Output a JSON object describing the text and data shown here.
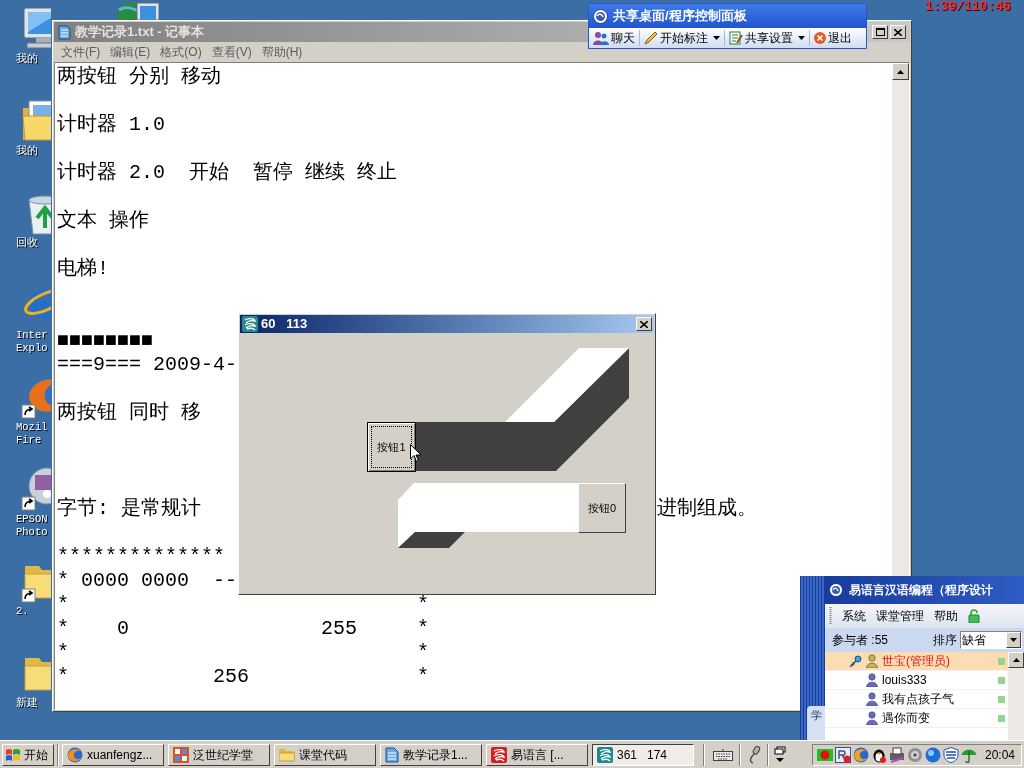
{
  "recording_time": "1:39/110:46",
  "desktop_icons": [
    {
      "kind": "computer",
      "lines": [
        "我的"
      ],
      "shortcut": false
    },
    {
      "kind": "documents",
      "lines": [
        "我的"
      ],
      "shortcut": false
    },
    {
      "kind": "recycle",
      "lines": [
        "回收"
      ],
      "shortcut": false
    },
    {
      "kind": "browser_e",
      "lines": [
        "Inter",
        "Explo"
      ],
      "shortcut": false
    },
    {
      "kind": "fox",
      "lines": [
        "Mozil",
        "Fire"
      ],
      "shortcut": true
    },
    {
      "kind": "photo",
      "lines": [
        "EPSON",
        "Photo"
      ],
      "shortcut": true
    },
    {
      "kind": "folder",
      "lines": [
        "2."
      ],
      "shortcut": true
    },
    {
      "kind": "folder",
      "lines": [
        "新建"
      ],
      "shortcut": false
    }
  ],
  "notepad": {
    "title": "教学记录1.txt - 记事本",
    "active": false,
    "menu": [
      "文件(F)",
      "编辑(E)",
      "格式(O)",
      "查看(V)",
      "帮助(H)"
    ],
    "lines": [
      {
        "kind": "text",
        "text": "两按钮 分别 移动"
      },
      {
        "kind": "blank"
      },
      {
        "kind": "text",
        "text": "计时器 1.0"
      },
      {
        "kind": "blank"
      },
      {
        "kind": "text",
        "text": "计时器 2.0  开始  暂停 继续 终止"
      },
      {
        "kind": "blank"
      },
      {
        "kind": "text",
        "text": "文本 操作"
      },
      {
        "kind": "blank"
      },
      {
        "kind": "text",
        "text": "电梯!"
      },
      {
        "kind": "blank"
      },
      {
        "kind": "blank"
      },
      {
        "kind": "split",
        "text": "■■■■■■■■"
      },
      {
        "kind": "split",
        "text": "===9=== 2009-4-"
      },
      {
        "kind": "blank"
      },
      {
        "kind": "split",
        "text": "两按钮 同时 移"
      },
      {
        "kind": "blank"
      },
      {
        "kind": "blank"
      },
      {
        "kind": "blank"
      },
      {
        "kind": "split",
        "text": "字节: 是常规计",
        "text_right": "进制组成。"
      },
      {
        "kind": "blank"
      },
      {
        "kind": "split",
        "text": "**************"
      },
      {
        "kind": "split",
        "text": "* 0000 0000  --"
      },
      {
        "kind": "text",
        "text": "*                             *"
      },
      {
        "kind": "text",
        "text": "*    0                255     *"
      },
      {
        "kind": "text",
        "text": "*                             *"
      },
      {
        "kind": "text",
        "text": "*            256              *"
      }
    ]
  },
  "dialog": {
    "title": "60   113",
    "active": true,
    "buttons": [
      {
        "label": "按钮1",
        "focused": true
      },
      {
        "label": "按钮0",
        "focused": false
      }
    ]
  },
  "share_panel": {
    "title": "共享桌面/程序控制面板",
    "buttons": [
      {
        "kind": "chat",
        "label": "聊天",
        "dropdown": false
      },
      {
        "kind": "pen",
        "label": "开始标注",
        "dropdown": true
      },
      {
        "kind": "settings",
        "label": "共享设置",
        "dropdown": true
      },
      {
        "kind": "exit",
        "label": "退出",
        "dropdown": false
      }
    ]
  },
  "chat_panel": {
    "title": "易语言汉语编程（程序设计",
    "menu": [
      "系统",
      "课堂管理",
      "帮助"
    ],
    "participants": "参与者 :55",
    "sort_label": "排序",
    "sort_value": "缺省",
    "side_tab": "学",
    "members": [
      {
        "kind": "admin",
        "name": "世宝(管理员)",
        "selected": true
      },
      {
        "kind": "member",
        "name": "louis333",
        "selected": false
      },
      {
        "kind": "member",
        "name": "我有点孩子气",
        "selected": false
      },
      {
        "kind": "member",
        "name": "遇你而变",
        "selected": false
      }
    ]
  },
  "taskbar": {
    "start": "开始",
    "tasks": [
      {
        "kind": "browser",
        "label": "xuanfengz...",
        "selected": false
      },
      {
        "kind": "grid_app",
        "label": "泛世纪学堂",
        "selected": false
      },
      {
        "kind": "folder",
        "label": "课堂代码",
        "selected": false
      },
      {
        "kind": "notepad",
        "label": "教学记录1...",
        "selected": false
      },
      {
        "kind": "yi",
        "label": "易语言 [...",
        "selected": false
      },
      {
        "kind": "yi_window",
        "label": "361   174",
        "selected": true
      }
    ],
    "clock": "20:04"
  }
}
